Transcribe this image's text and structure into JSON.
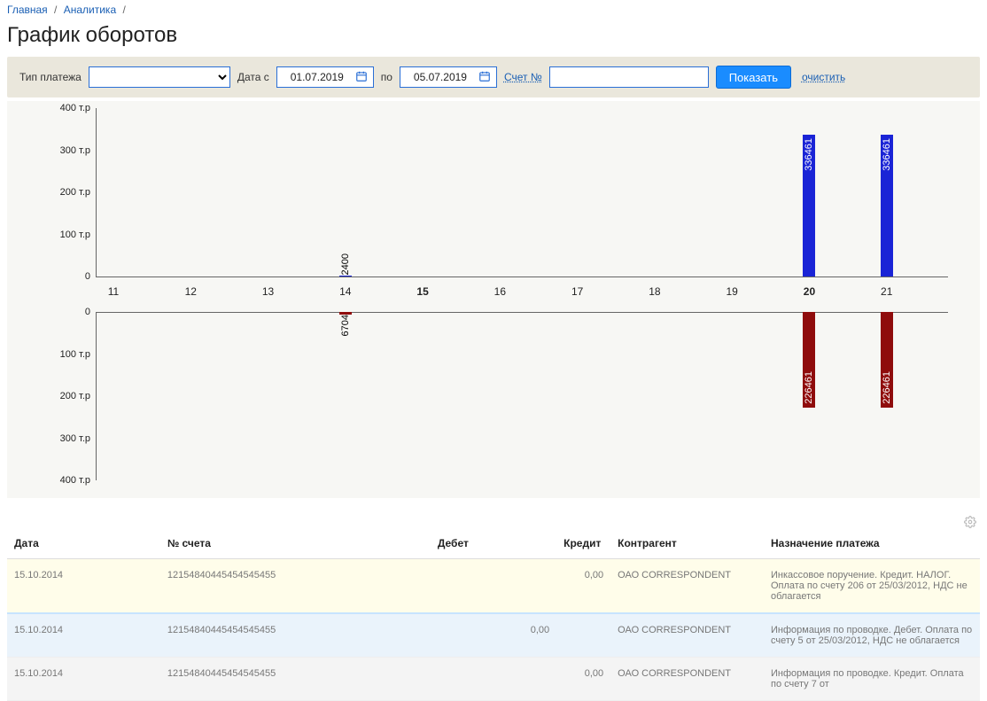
{
  "breadcrumb": {
    "home": "Главная",
    "analytics": "Аналитика"
  },
  "page_title": "График оборотов",
  "filter": {
    "type_label": "Тип платежа",
    "date_from_label": "Дата с",
    "date_to_label": "по",
    "date_from": "01.07.2019",
    "date_to": "05.07.2019",
    "account_label": "Счет №",
    "account_value": "",
    "show_button": "Показать",
    "clear_link": "очистить"
  },
  "chart_data": {
    "type": "bar",
    "ylabel_unit": "т.р",
    "y_ticks_positive": [
      "400 т.р",
      "300 т.р",
      "200 т.р",
      "100 т.р",
      "0"
    ],
    "y_ticks_negative": [
      "0",
      "100 т.р",
      "200 т.р",
      "300 т.р",
      "400 т.р"
    ],
    "ylim": [
      -400,
      400
    ],
    "categories": [
      "11",
      "12",
      "13",
      "14",
      "15",
      "16",
      "17",
      "18",
      "19",
      "20",
      "21"
    ],
    "bold_category": "15",
    "active_category": "20",
    "series": [
      {
        "name": "credit",
        "values": [
          null,
          null,
          null,
          2400,
          null,
          null,
          null,
          null,
          null,
          336461,
          336461
        ]
      },
      {
        "name": "debit",
        "values": [
          null,
          null,
          null,
          6704,
          null,
          null,
          null,
          null,
          null,
          226461,
          226461
        ]
      }
    ]
  },
  "table": {
    "columns": [
      "Дата",
      "№ счета",
      "Дебет",
      "Кредит",
      "Контрагент",
      "Назначение платежа"
    ],
    "rows": [
      {
        "date": "15.10.2014",
        "acct": "12154840445454545455",
        "debit": "",
        "credit": "0,00",
        "ctr": "ОАО CORRESPONDENT",
        "purpose": "Инкассовое поручение. Кредит. НАЛОГ. Оплата по счету 206 от 25/03/2012, НДС не облагается"
      },
      {
        "date": "15.10.2014",
        "acct": "12154840445454545455",
        "debit": "0,00",
        "credit": "",
        "ctr": "ОАО CORRESPONDENT",
        "purpose": "Информация по проводке. Дебет. Оплата по счету 5 от 25/03/2012, НДС не облагается"
      },
      {
        "date": "15.10.2014",
        "acct": "12154840445454545455",
        "debit": "",
        "credit": "0,00",
        "ctr": "ОАО CORRESPONDENT",
        "purpose": "Информация по проводке. Кредит. Оплата по счету 7 от"
      }
    ]
  }
}
